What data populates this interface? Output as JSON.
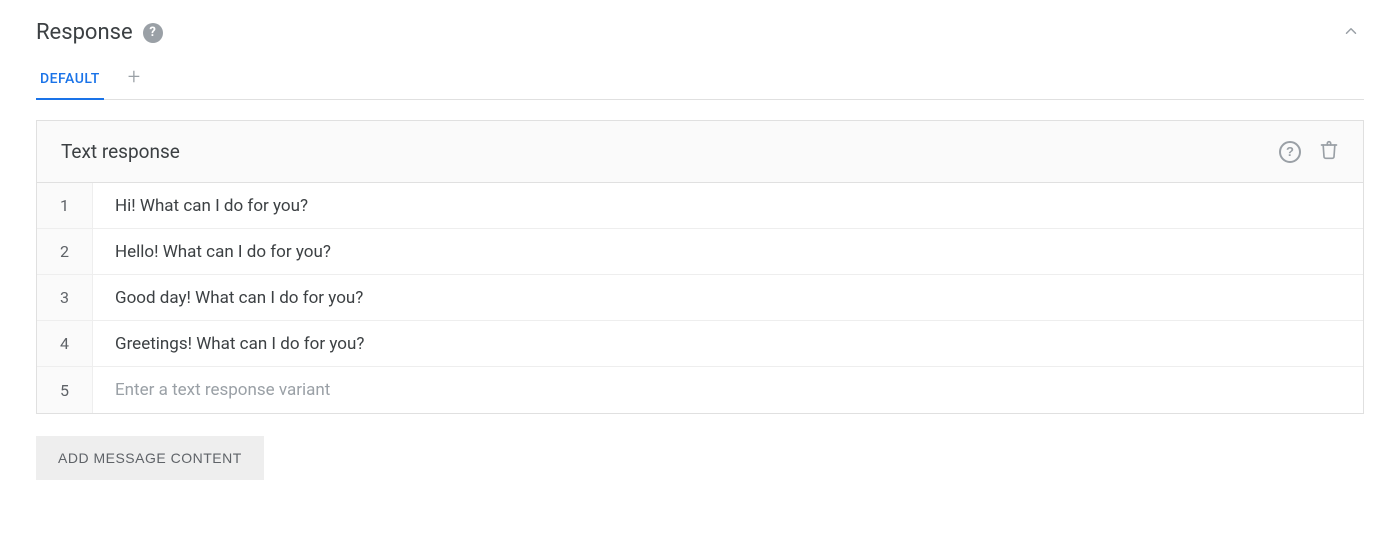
{
  "section": {
    "title": "Response",
    "help_symbol": "?"
  },
  "tabs": {
    "active": "DEFAULT",
    "add_symbol": "+"
  },
  "card": {
    "title": "Text response"
  },
  "rows": [
    {
      "index": "1",
      "text": "Hi! What can I do for you?",
      "isPlaceholder": false
    },
    {
      "index": "2",
      "text": "Hello! What can I do for you?",
      "isPlaceholder": false
    },
    {
      "index": "3",
      "text": "Good day! What can I do for you?",
      "isPlaceholder": false
    },
    {
      "index": "4",
      "text": "Greetings! What can I do for you?",
      "isPlaceholder": false
    },
    {
      "index": "5",
      "text": "Enter a text response variant",
      "isPlaceholder": true
    }
  ],
  "addButton": {
    "label": "ADD MESSAGE CONTENT"
  }
}
